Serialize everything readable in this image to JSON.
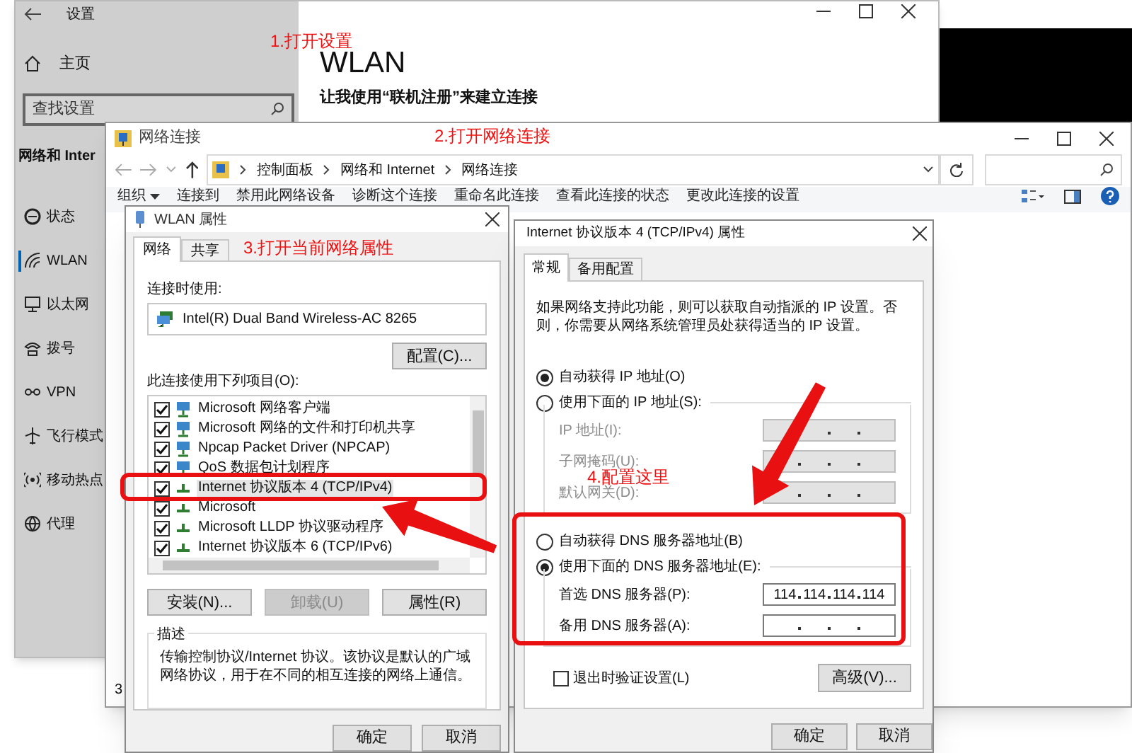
{
  "settings_window": {
    "title": "设置",
    "home": "主页",
    "search": {
      "placeholder": "查找设置"
    },
    "section": "网络和 Inter",
    "nav": [
      {
        "label": "状态",
        "selected": false
      },
      {
        "label": "WLAN",
        "selected": true
      },
      {
        "label": "以太网",
        "selected": false
      },
      {
        "label": "拨号",
        "selected": false
      },
      {
        "label": "VPN",
        "selected": false
      },
      {
        "label": "飞行模式",
        "selected": false
      },
      {
        "label": "移动热点",
        "selected": false
      },
      {
        "label": "代理",
        "selected": false
      }
    ],
    "page_title": "WLAN",
    "page_subtitle": "让我使用“联机注册”来建立连接"
  },
  "network_connections": {
    "title": "网络连接",
    "breadcrumb": [
      "控制面板",
      "网络和 Internet",
      "网络连接"
    ],
    "toolbar": [
      "组织",
      "连接到",
      "禁用此网络设备",
      "诊断这个连接",
      "重命名此连接",
      "查看此连接的状态",
      "更改此连接的设置"
    ],
    "status_bar": "3"
  },
  "wlan_dialog": {
    "title": "WLAN 属性",
    "tabs": [
      {
        "label": "网络",
        "selected": true
      },
      {
        "label": "共享",
        "selected": false
      }
    ],
    "connect_using_label": "连接时使用:",
    "adapter": "Intel(R) Dual Band Wireless-AC 8265",
    "configure_button": "配置(C)...",
    "items_label": "此连接使用下列项目(O):",
    "items": [
      {
        "kind": "service",
        "label": "Microsoft 网络客户端",
        "checked": true,
        "selected": false
      },
      {
        "kind": "service",
        "label": "Microsoft 网络的文件和打印机共享",
        "checked": true,
        "selected": false
      },
      {
        "kind": "service",
        "label": "Npcap Packet Driver (NPCAP)",
        "checked": true,
        "selected": false
      },
      {
        "kind": "service",
        "label": "QoS 数据包计划程序",
        "checked": true,
        "selected": false
      },
      {
        "kind": "protocol",
        "label": "Internet 协议版本 4 (TCP/IPv4)",
        "checked": true,
        "selected": true
      },
      {
        "kind": "protocol",
        "label": "Microsoft",
        "checked": true,
        "selected": false
      },
      {
        "kind": "protocol",
        "label": "Microsoft LLDP 协议驱动程序",
        "checked": true,
        "selected": false
      },
      {
        "kind": "protocol",
        "label": "Internet 协议版本 6 (TCP/IPv6)",
        "checked": true,
        "selected": false
      }
    ],
    "buttons": [
      {
        "label": "安装(N)...",
        "disabled": false
      },
      {
        "label": "卸载(U)",
        "disabled": true
      },
      {
        "label": "属性(R)",
        "disabled": false
      }
    ],
    "description_title": "描述",
    "description": "传输控制协议/Internet 协议。该协议是默认的广域网络协议，用于在不同的相互连接的网络上通信。",
    "footer_buttons": [
      "确定",
      "取消"
    ]
  },
  "ipv4_dialog": {
    "title": "Internet 协议版本 4 (TCP/IPv4) 属性",
    "tabs": [
      {
        "label": "常规",
        "selected": true
      },
      {
        "label": "备用配置",
        "selected": false
      }
    ],
    "intro": "如果网络支持此功能，则可以获取自动指派的 IP 设置。否则，你需要从网络系统管理员处获得适当的 IP 设置。",
    "ip_mode": [
      {
        "label": "自动获得 IP 地址(O)",
        "selected": true
      },
      {
        "label": "使用下面的 IP 地址(S):",
        "selected": false
      }
    ],
    "ip_fields": [
      {
        "label": "IP 地址(I):",
        "disabled": true
      },
      {
        "label": "子网掩码(U):",
        "disabled": true
      },
      {
        "label": "默认网关(D):",
        "disabled": true
      }
    ],
    "dns_mode": [
      {
        "label": "自动获得 DNS 服务器地址(B)",
        "selected": false
      },
      {
        "label": "使用下面的 DNS 服务器地址(E):",
        "selected": true
      }
    ],
    "dns_fields": [
      {
        "label": "首选 DNS 服务器(P):",
        "disabled": false,
        "octets": [
          "114",
          "114",
          "114",
          "114"
        ]
      },
      {
        "label": "备用 DNS 服务器(A):",
        "disabled": false
      }
    ],
    "validate": {
      "label": "退出时验证设置(L)",
      "checked": false
    },
    "advanced_button": "高级(V)...",
    "footer_buttons": [
      "确定",
      "取消"
    ]
  },
  "annotations": [
    {
      "text": "1.打开设置"
    },
    {
      "text": "2.打开网络连接"
    },
    {
      "text": "3.打开当前网络属性"
    },
    {
      "text": "4.配置这里"
    }
  ]
}
